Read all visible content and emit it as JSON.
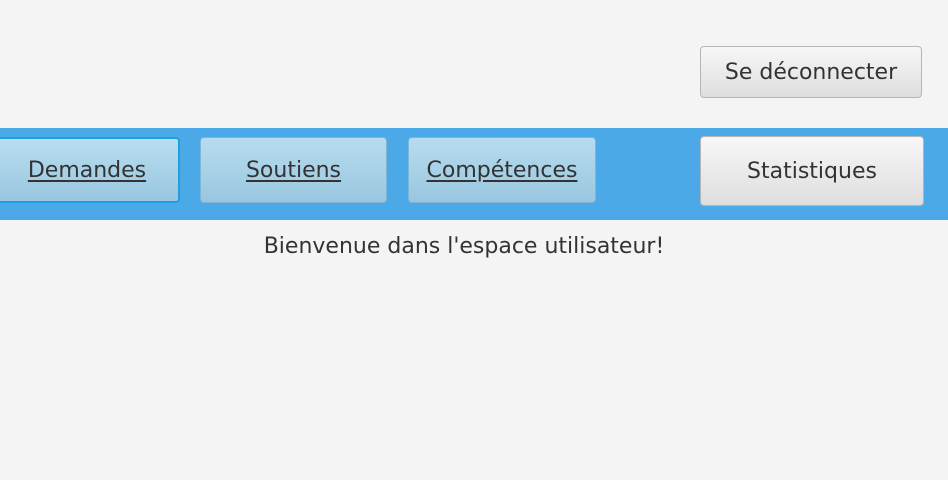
{
  "header": {
    "logout_label": "Se déconnecter"
  },
  "nav": {
    "items": [
      {
        "label": "Demandes"
      },
      {
        "label": "Soutiens"
      },
      {
        "label": "Compétences"
      },
      {
        "label": "Statistiques"
      }
    ]
  },
  "main": {
    "welcome": "Bienvenue dans l'espace utilisateur!"
  },
  "colors": {
    "background": "#f4f4f4",
    "nav_bar": "#4aa9e6",
    "nav_button": "#a8d3ea",
    "focus_border": "#1e9fe0",
    "text": "#333333"
  }
}
